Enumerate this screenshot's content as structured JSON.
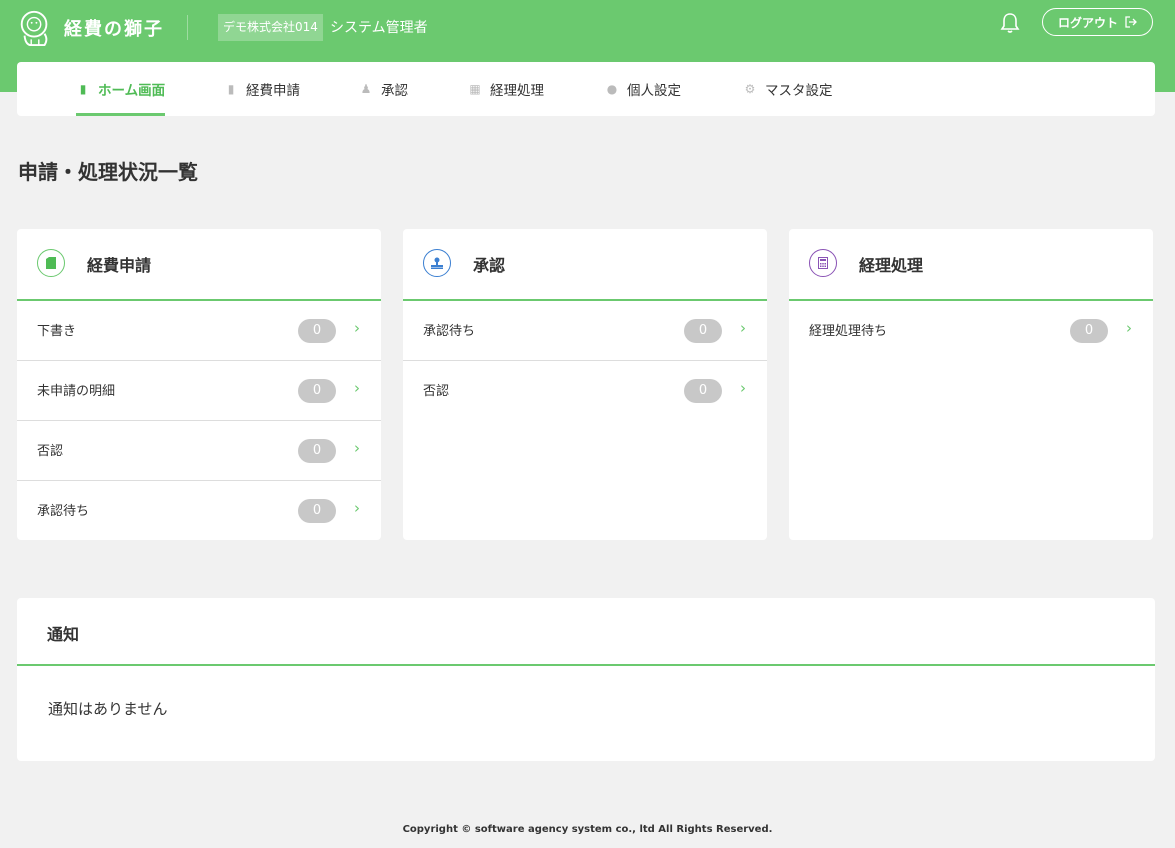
{
  "header": {
    "brand": "経費の獅子",
    "company": "デモ株式会社014",
    "role": "システム管理者",
    "logout_label": "ログアウト"
  },
  "nav": {
    "items": [
      {
        "label": "ホーム画面",
        "icon": "document-icon",
        "active": true
      },
      {
        "label": "経費申請",
        "icon": "document-icon"
      },
      {
        "label": "承認",
        "icon": "stamp-icon"
      },
      {
        "label": "経理処理",
        "icon": "calculator-icon"
      },
      {
        "label": "個人設定",
        "icon": "person-icon"
      },
      {
        "label": "マスタ設定",
        "icon": "gear-icon"
      }
    ]
  },
  "page_title": "申請・処理状況一覧",
  "cards": [
    {
      "title": "経費申請",
      "icon": "document-icon",
      "color": "#4fbb55",
      "rows": [
        {
          "label": "下書き",
          "count": "0"
        },
        {
          "label": "未申請の明細",
          "count": "0"
        },
        {
          "label": "否認",
          "count": "0"
        },
        {
          "label": "承認待ち",
          "count": "0"
        }
      ]
    },
    {
      "title": "承認",
      "icon": "stamp-icon",
      "color": "#3b7fd1",
      "rows": [
        {
          "label": "承認待ち",
          "count": "0"
        },
        {
          "label": "否認",
          "count": "0"
        }
      ]
    },
    {
      "title": "経理処理",
      "icon": "calculator-icon",
      "color": "#8a53b5",
      "rows": [
        {
          "label": "経理処理待ち",
          "count": "0"
        }
      ]
    }
  ],
  "notice": {
    "title": "通知",
    "empty_text": "通知はありません"
  },
  "footer": "Copyright © software agency system co., ltd All Rights Reserved.",
  "colors": {
    "accent": "#6bc96f",
    "background": "#f1f1f1"
  }
}
